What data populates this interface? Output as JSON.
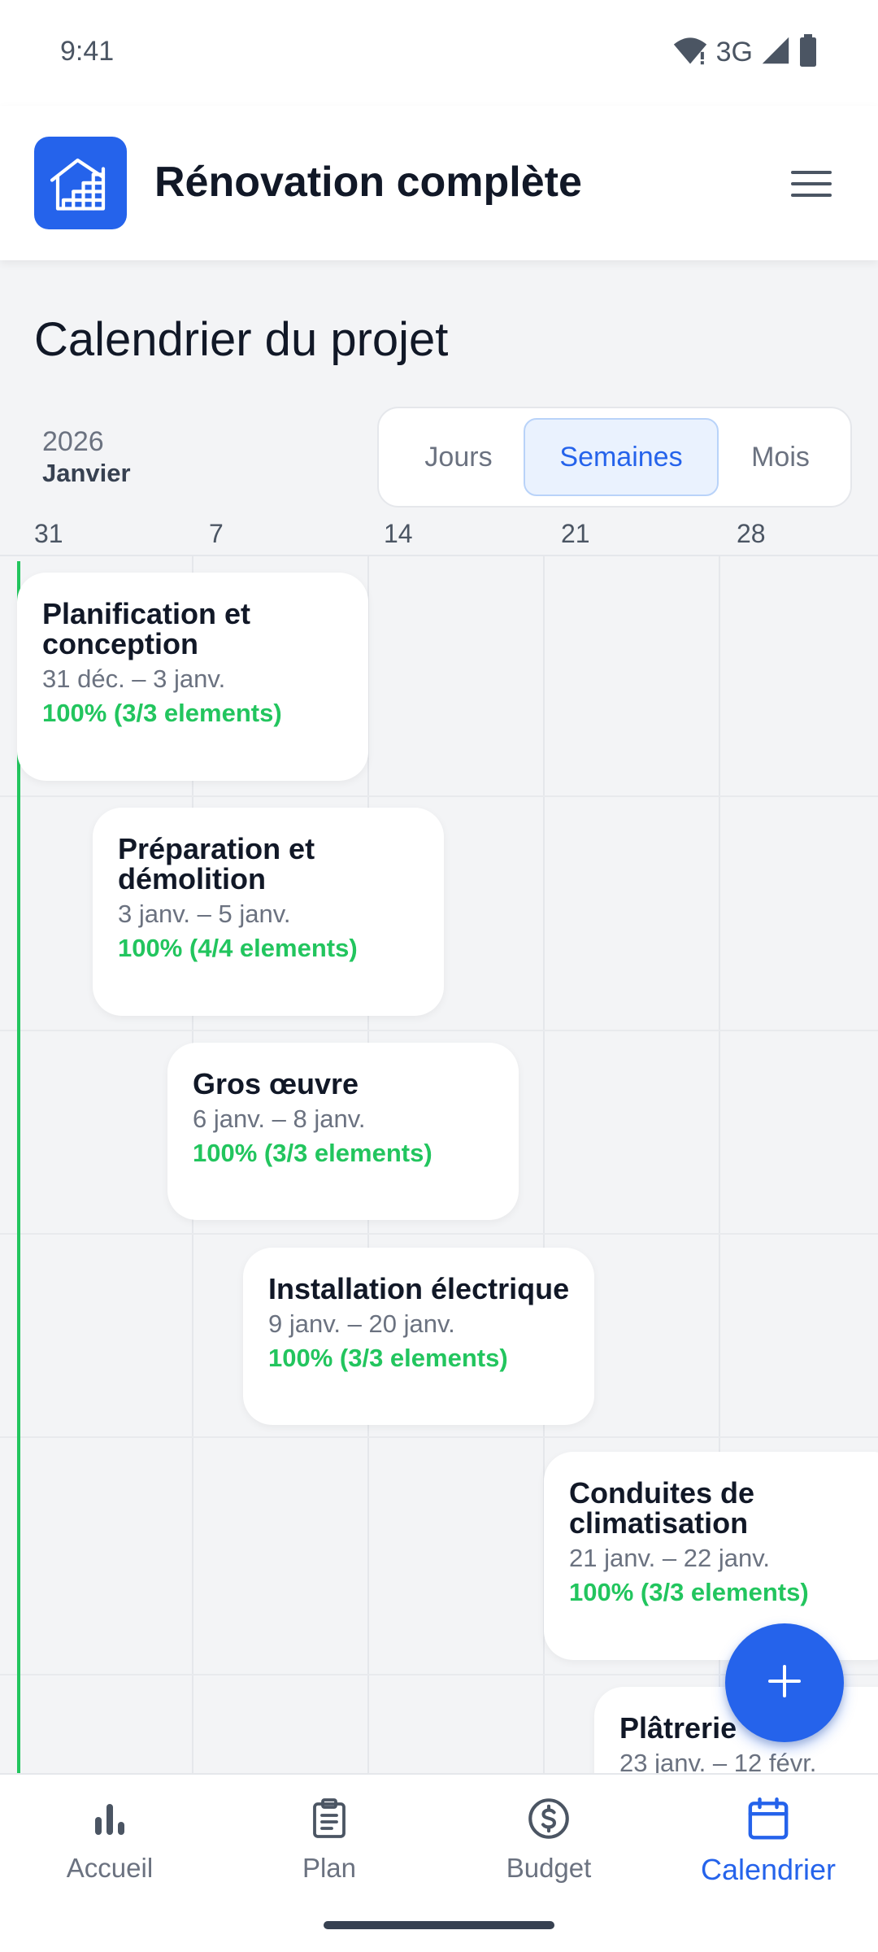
{
  "status_bar": {
    "time": "9:41",
    "network": "3G"
  },
  "header": {
    "title": "Rénovation complète",
    "logo_icon": "house-stairs-icon",
    "menu_icon": "hamburger-menu-icon"
  },
  "calendar": {
    "page_title": "Calendrier du projet",
    "year": "2026",
    "month": "Janvier",
    "view_options": [
      {
        "label": "Jours",
        "active": false
      },
      {
        "label": "Semaines",
        "active": true
      },
      {
        "label": "Mois",
        "active": false
      }
    ],
    "week_labels": [
      "31",
      "7",
      "14",
      "21",
      "28"
    ],
    "tasks": [
      {
        "title": "Planification et conception",
        "dates": "31 déc. – 3 janv.",
        "progress": "100% (3/3 elements)"
      },
      {
        "title": "Préparation et démolition",
        "dates": "3 janv. – 5 janv.",
        "progress": "100% (4/4 elements)"
      },
      {
        "title": "Gros œuvre",
        "dates": "6 janv. – 8 janv.",
        "progress": "100% (3/3 elements)"
      },
      {
        "title": "Installation électrique",
        "dates": "9 janv. – 20 janv.",
        "progress": "100% (3/3 elements)"
      },
      {
        "title": "Conduites de climatisation",
        "dates": "21 janv. – 22 janv.",
        "progress": "100% (3/3 elements)"
      },
      {
        "title": "Plâtrerie",
        "dates": "23 janv. – 12 févr.",
        "progress": ""
      }
    ]
  },
  "fab_icon": "plus-icon",
  "bottom_nav": [
    {
      "label": "Accueil",
      "icon": "bar-chart-icon",
      "active": false
    },
    {
      "label": "Plan",
      "icon": "clipboard-icon",
      "active": false
    },
    {
      "label": "Budget",
      "icon": "dollar-circle-icon",
      "active": false
    },
    {
      "label": "Calendrier",
      "icon": "calendar-icon",
      "active": true
    }
  ],
  "colors": {
    "accent": "#2563eb",
    "success": "#22c55e",
    "background": "#f3f4f6"
  }
}
